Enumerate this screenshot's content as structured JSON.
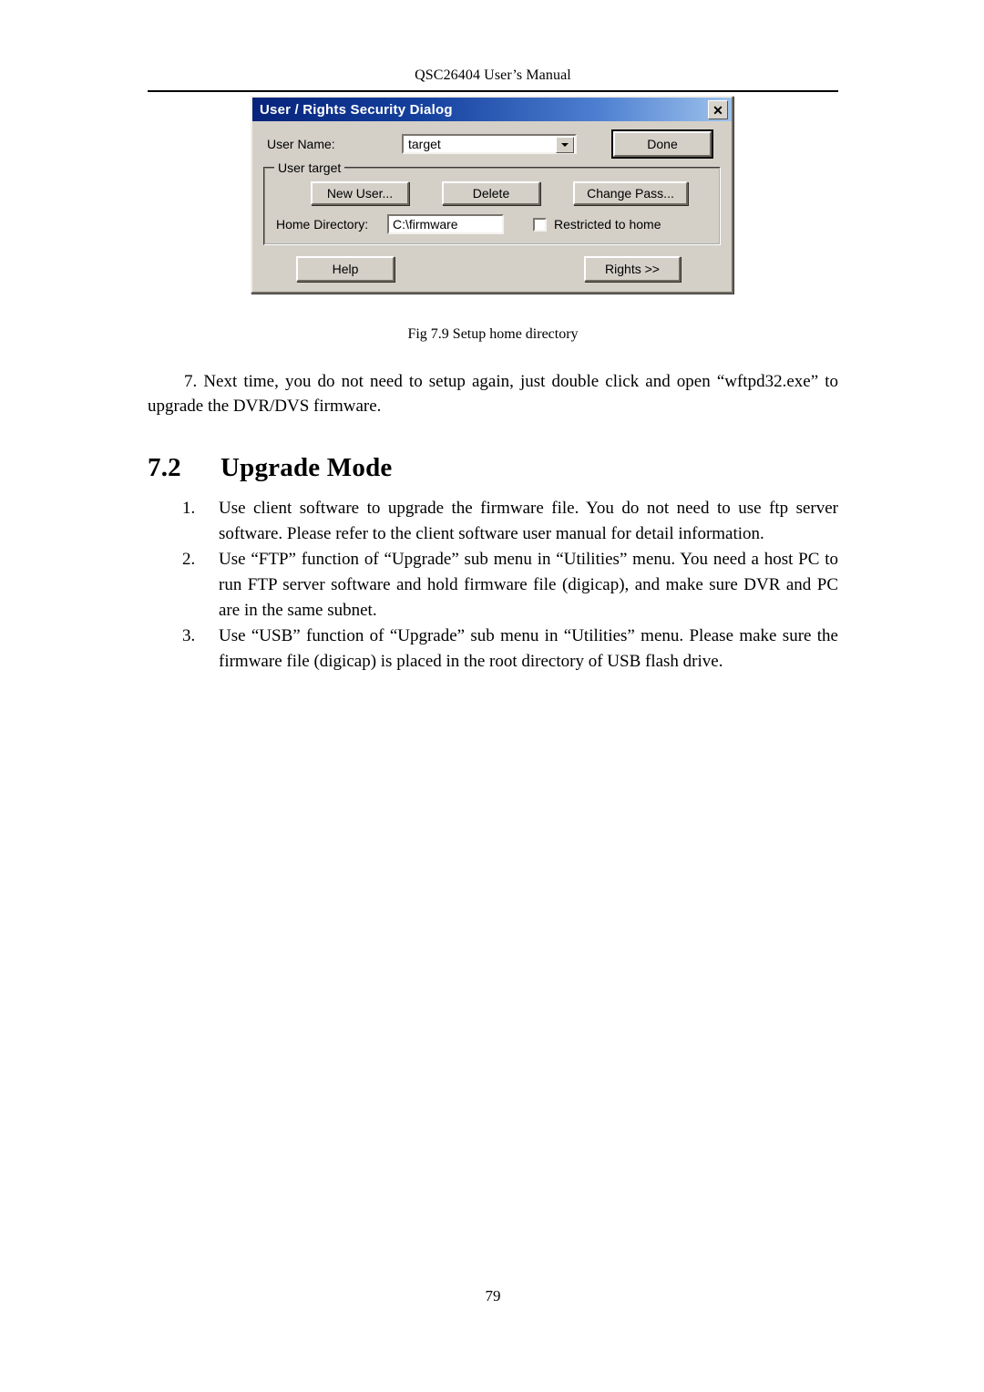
{
  "header": {
    "running_title": "QSC26404 User’s Manual"
  },
  "dialog": {
    "title": "User / Rights Security Dialog",
    "close_icon_label": "✕",
    "username_label": "User Name:",
    "username_value": "target",
    "done_label": "Done",
    "group_label": "User target",
    "new_user_label": "New User...",
    "delete_label": "Delete",
    "change_pass_label": "Change Pass...",
    "home_directory_label": "Home Directory:",
    "home_directory_value": "C:\\firmware",
    "restricted_label": "Restricted to home",
    "restricted_checked": false,
    "help_label": "Help",
    "rights_label": "Rights >>",
    "titlebar_color_start": "#07237b",
    "titlebar_color_end": "#9fc3ec",
    "face_color": "#d4d0c8"
  },
  "figure": {
    "caption": "Fig 7.9 Setup home directory"
  },
  "body": {
    "step7": "7. Next time, you do not need to setup again, just double click and open “wftpd32.exe” to upgrade the DVR/DVS firmware.",
    "heading_number": "7.2",
    "heading_title": "Upgrade Mode",
    "list": [
      {
        "marker": "1.",
        "text": "Use client software to upgrade the firmware file. You do not need to use ftp server software. Please refer to the client software user manual for detail information."
      },
      {
        "marker": "2.",
        "text": "Use “FTP” function of “Upgrade” sub menu in “Utilities” menu. You need a host PC to run FTP server software and hold firmware file (digicap), and make sure DVR and PC are in the same subnet."
      },
      {
        "marker": "3.",
        "text": "Use “USB” function of “Upgrade” sub menu in “Utilities” menu. Please make sure the firmware file (digicap) is placed in the root directory of USB flash drive."
      }
    ]
  },
  "footer": {
    "page_number": "79"
  }
}
